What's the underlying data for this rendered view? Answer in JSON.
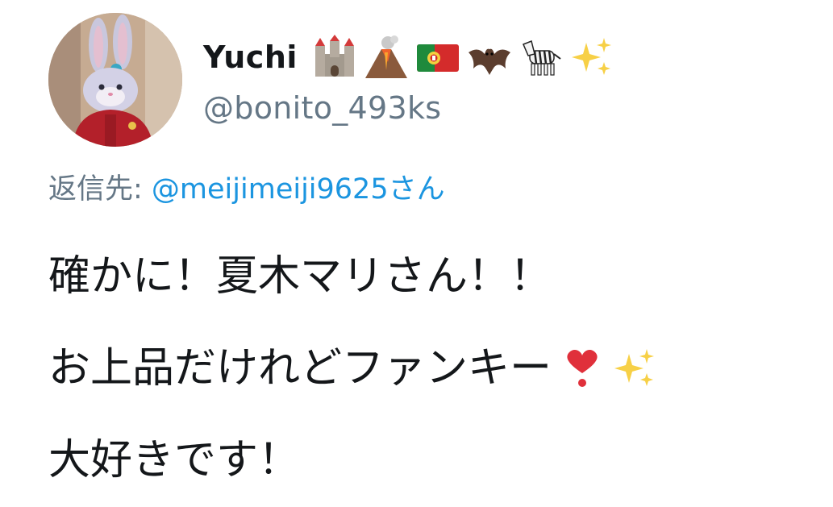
{
  "tweet": {
    "author": {
      "display_name": "Yuchi",
      "name_emojis": [
        "castle-icon",
        "volcano-icon",
        "portugal-flag-icon",
        "bat-icon",
        "zebra-icon",
        "sparkles-icon"
      ],
      "handle": "@bonito_493ks"
    },
    "reply": {
      "prefix": "返信先: ",
      "mention": "@meijimeiji9625",
      "suffix": "さん"
    },
    "body": {
      "line1": "確かに！夏木マリさん！！",
      "line2": "お上品だけれどファンキー",
      "line2_emojis": [
        "heavy-heart-exclamation-icon",
        "sparkles-icon"
      ],
      "line3": "大好きです！"
    }
  }
}
